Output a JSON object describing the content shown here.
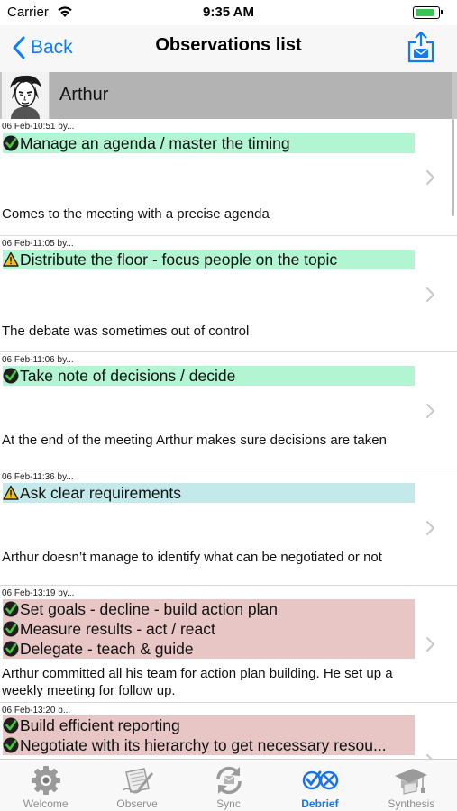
{
  "status_bar": {
    "carrier": "Carrier",
    "time": "9:35 AM",
    "battery_level": 0.85
  },
  "nav": {
    "back_label": "Back",
    "title": "Observations list"
  },
  "person": {
    "name": "Arthur"
  },
  "colors": {
    "accent": "#0f7cf6",
    "green": "#b2f5d2",
    "blue": "#c4e9ea",
    "red": "#e9c6c6"
  },
  "observations": [
    {
      "date": "06 Feb-10:51 by...",
      "lines": [
        {
          "status": "check",
          "text": "Manage an agenda / master the timing"
        }
      ],
      "color": "green",
      "comment": "Comes to the meeting with a precise agenda"
    },
    {
      "date": "06 Feb-11:05 by...",
      "lines": [
        {
          "status": "warning",
          "text": "Distribute the floor - focus people on the topic"
        }
      ],
      "color": "green",
      "comment": "The debate was sometimes out of control"
    },
    {
      "date": "06 Feb-11:06 by...",
      "lines": [
        {
          "status": "check",
          "text": "Take note of decisions / decide"
        }
      ],
      "color": "green",
      "comment": "At the end of the meeting Arthur makes sure decisions are taken"
    },
    {
      "date": "06 Feb-11:36 by...",
      "lines": [
        {
          "status": "warning",
          "text": "Ask clear requirements"
        }
      ],
      "color": "blue",
      "comment": "Arthur doesn’t manage to identify what can be negotiated or not"
    },
    {
      "date": "06 Feb-13:19 by...",
      "lines": [
        {
          "status": "check",
          "text": "Set goals - decline - build action plan"
        },
        {
          "status": "check",
          "text": "Measure results - act / react"
        },
        {
          "status": "check",
          "text": "Delegate - teach & guide"
        }
      ],
      "color": "red",
      "comment": "Arthur committed all his team for action plan building. He set up a weekly meeting for follow up."
    },
    {
      "date": "06 Feb-13:20 b...",
      "lines": [
        {
          "status": "check",
          "text": "Build efficient reporting"
        },
        {
          "status": "check",
          "text": "Negotiate with its hierarchy to get necessary resou..."
        }
      ],
      "color": "red",
      "comment": ""
    }
  ],
  "tabs": [
    {
      "label": "Welcome",
      "icon": "gear-icon",
      "active": false
    },
    {
      "label": "Observe",
      "icon": "notebook-icon",
      "active": false
    },
    {
      "label": "Sync",
      "icon": "sync-icon",
      "active": false
    },
    {
      "label": "Debrief",
      "icon": "debrief-checks-icon",
      "active": true
    },
    {
      "label": "Synthesis",
      "icon": "graduation-cap-icon",
      "active": false
    }
  ]
}
